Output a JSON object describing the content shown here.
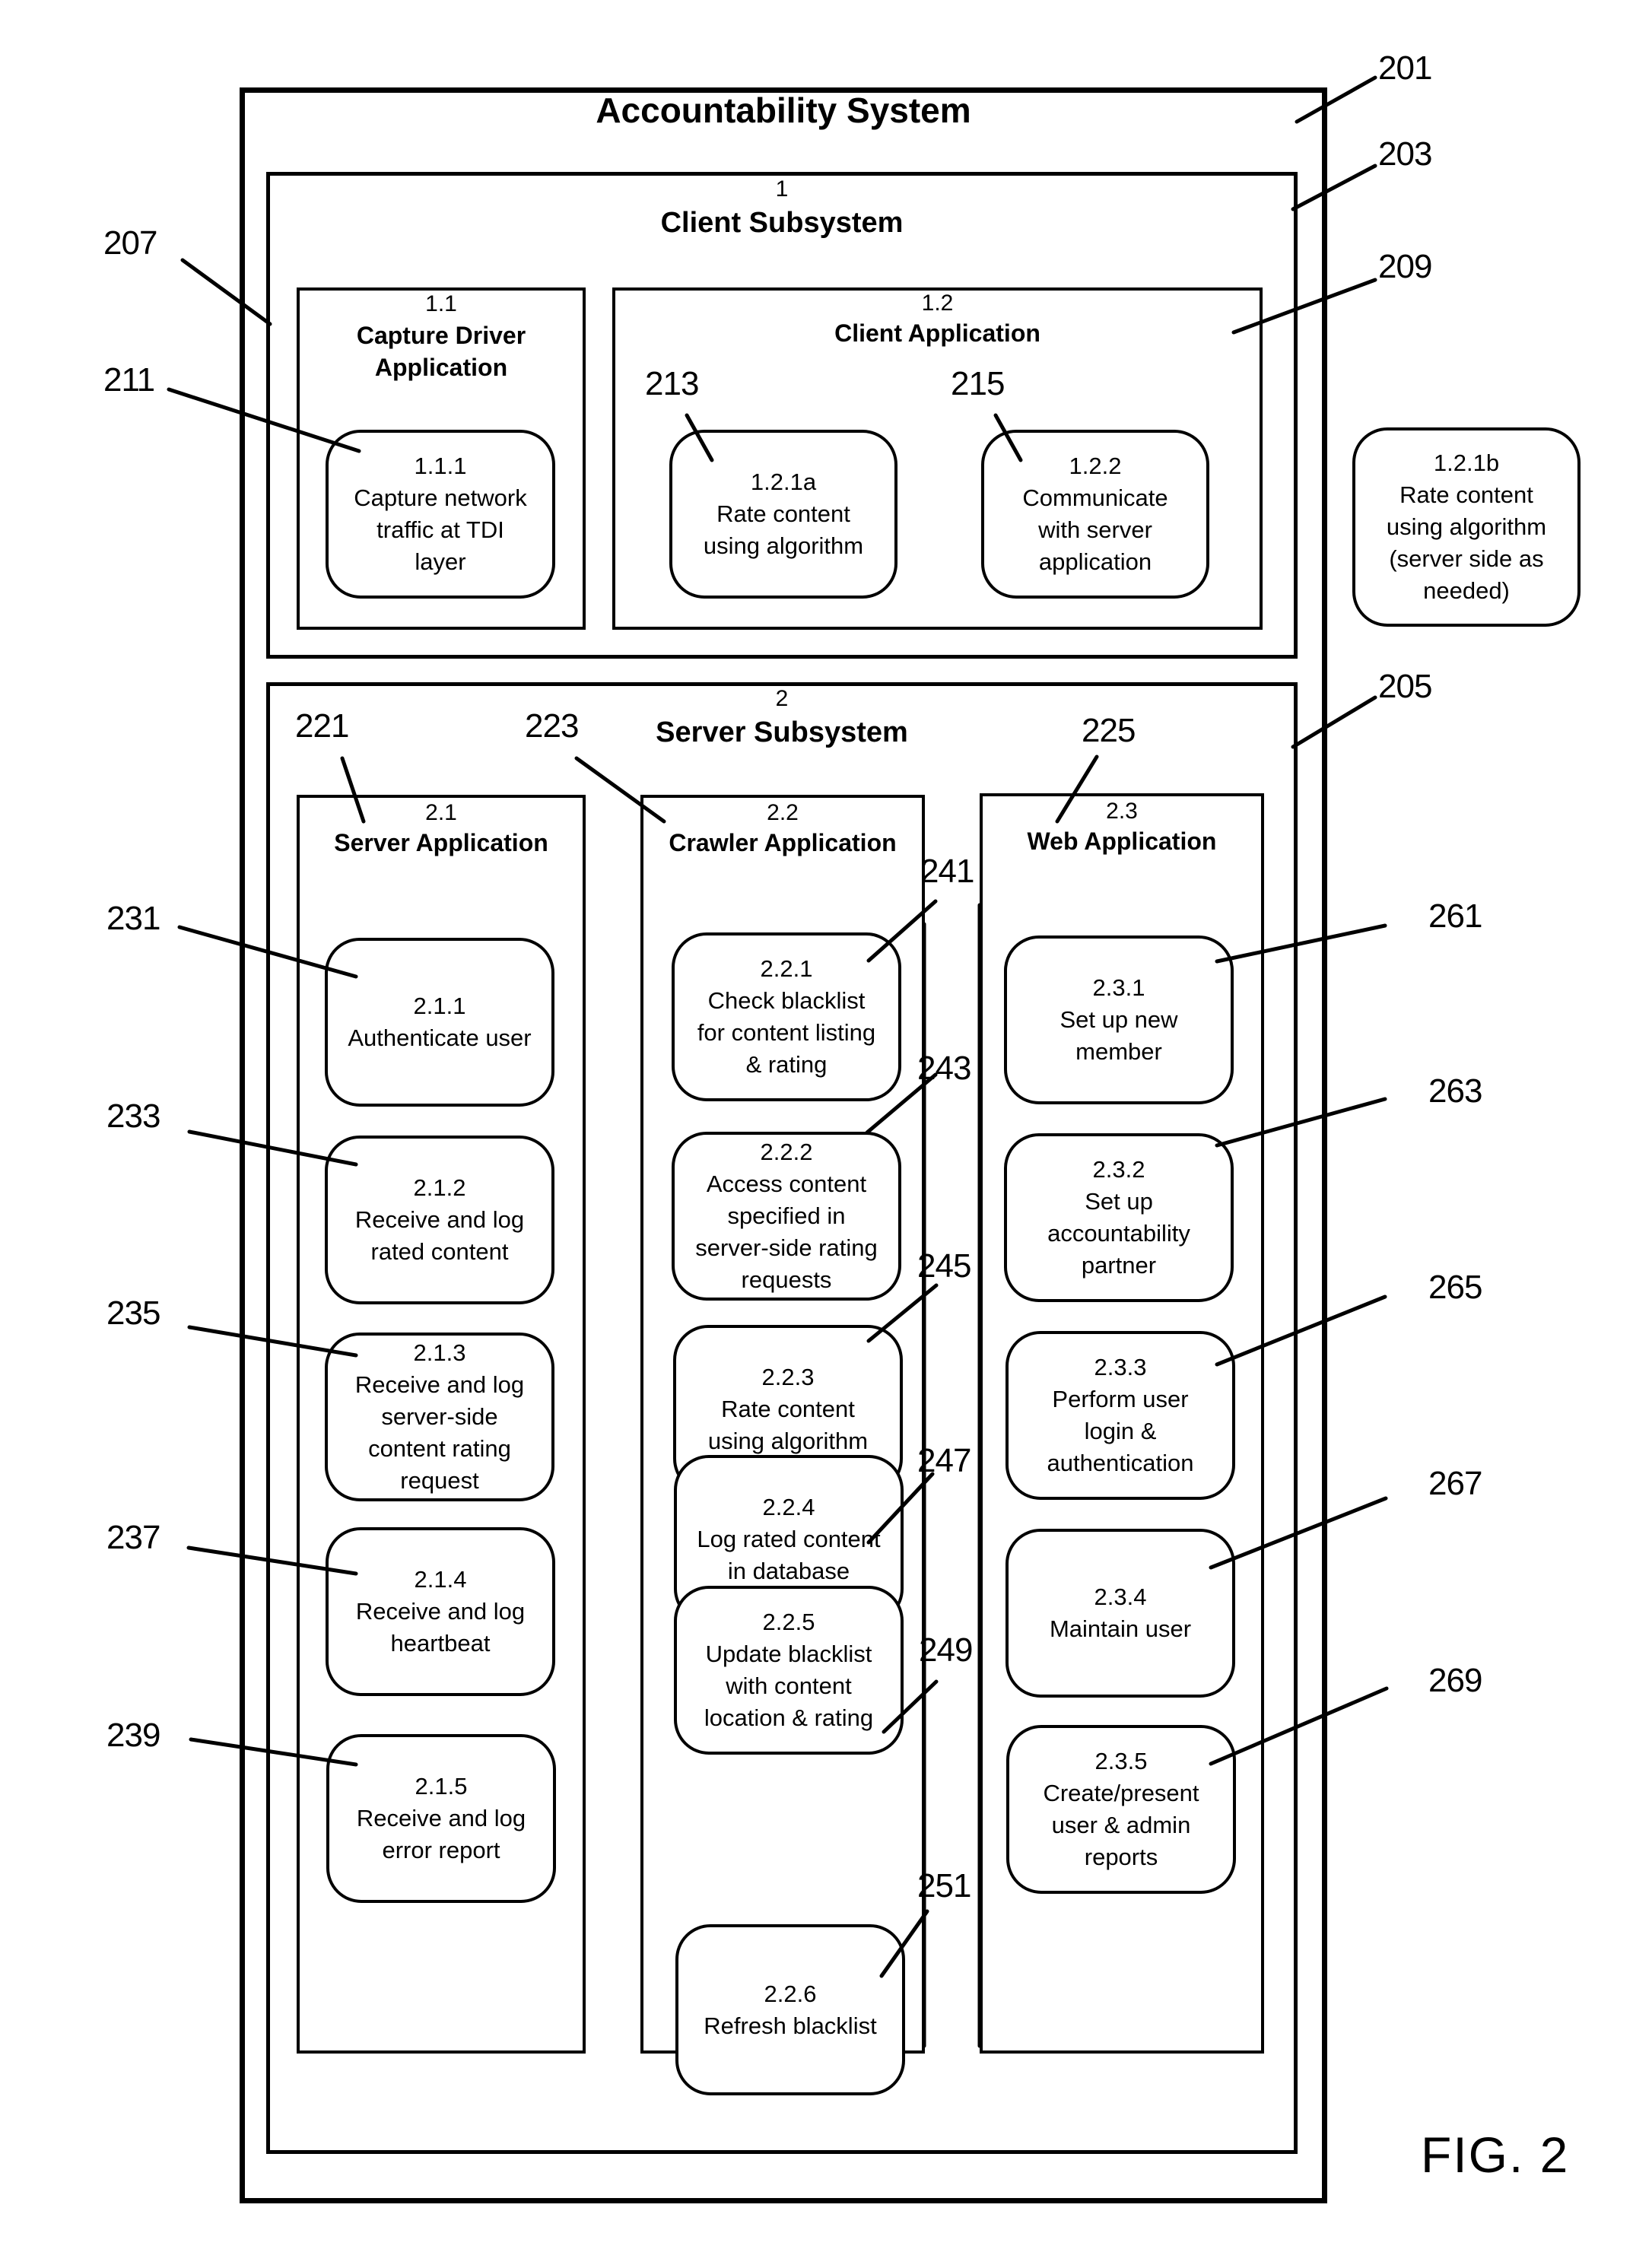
{
  "system": {
    "title": "Accountability System",
    "ref": "201"
  },
  "client": {
    "number": "1",
    "title": "Client Subsystem",
    "ref": "203",
    "capture_driver": {
      "number": "1.1",
      "title": "Capture Driver\nApplication",
      "ref": "207",
      "items": [
        {
          "number": "1.1.1",
          "label": "Capture network\ntraffic at TDI\nlayer",
          "ref": "211"
        }
      ]
    },
    "client_app": {
      "number": "1.2",
      "title": "Client Application",
      "ref": "209",
      "items": [
        {
          "number": "1.2.1a",
          "label": "Rate content\nusing algorithm",
          "ref": "213"
        },
        {
          "number": "1.2.2",
          "label": "Communicate\nwith server\napplication",
          "ref": "215"
        }
      ]
    },
    "external": {
      "number": "1.2.1b",
      "label": "Rate content\nusing algorithm\n(server side as\nneeded)"
    }
  },
  "server": {
    "number": "2",
    "title": "Server Subsystem",
    "ref": "205",
    "server_app": {
      "number": "2.1",
      "title": "Server Application",
      "ref": "221",
      "items": [
        {
          "number": "2.1.1",
          "label": "Authenticate user",
          "ref": "231"
        },
        {
          "number": "2.1.2",
          "label": "Receive and log\nrated content",
          "ref": "233"
        },
        {
          "number": "2.1.3",
          "label": "Receive and log\nserver-side\ncontent rating\nrequest",
          "ref": "235"
        },
        {
          "number": "2.1.4",
          "label": "Receive and log\nheartbeat",
          "ref": "237"
        },
        {
          "number": "2.1.5",
          "label": "Receive and log\nerror report",
          "ref": "239"
        }
      ]
    },
    "crawler_app": {
      "number": "2.2",
      "title": "Crawler Application",
      "ref": "223",
      "items": [
        {
          "number": "2.2.1",
          "label": "Check blacklist\nfor content listing\n& rating",
          "ref": "241"
        },
        {
          "number": "2.2.2",
          "label": "Access content\nspecified in\nserver-side rating\nrequests",
          "ref": "243"
        },
        {
          "number": "2.2.3",
          "label": "Rate content\nusing algorithm",
          "ref": "245"
        },
        {
          "number": "2.2.4",
          "label": "Log rated content\nin database",
          "ref": "247"
        },
        {
          "number": "2.2.5",
          "label": "Update blacklist\nwith content\nlocation & rating",
          "ref": "249"
        },
        {
          "number": "2.2.6",
          "label": "Refresh blacklist",
          "ref": "251"
        }
      ]
    },
    "web_app": {
      "number": "2.3",
      "title": "Web Application",
      "ref": "225",
      "items": [
        {
          "number": "2.3.1",
          "label": "Set up new\nmember",
          "ref": "261"
        },
        {
          "number": "2.3.2",
          "label": "Set up\naccountability\npartner",
          "ref": "263"
        },
        {
          "number": "2.3.3",
          "label": "Perform user\nlogin &\nauthentication",
          "ref": "265"
        },
        {
          "number": "2.3.4",
          "label": "Maintain user",
          "ref": "267"
        },
        {
          "number": "2.3.5",
          "label": "Create/present\nuser & admin\nreports",
          "ref": "269"
        }
      ]
    }
  },
  "figure_label": "FIG. 2"
}
